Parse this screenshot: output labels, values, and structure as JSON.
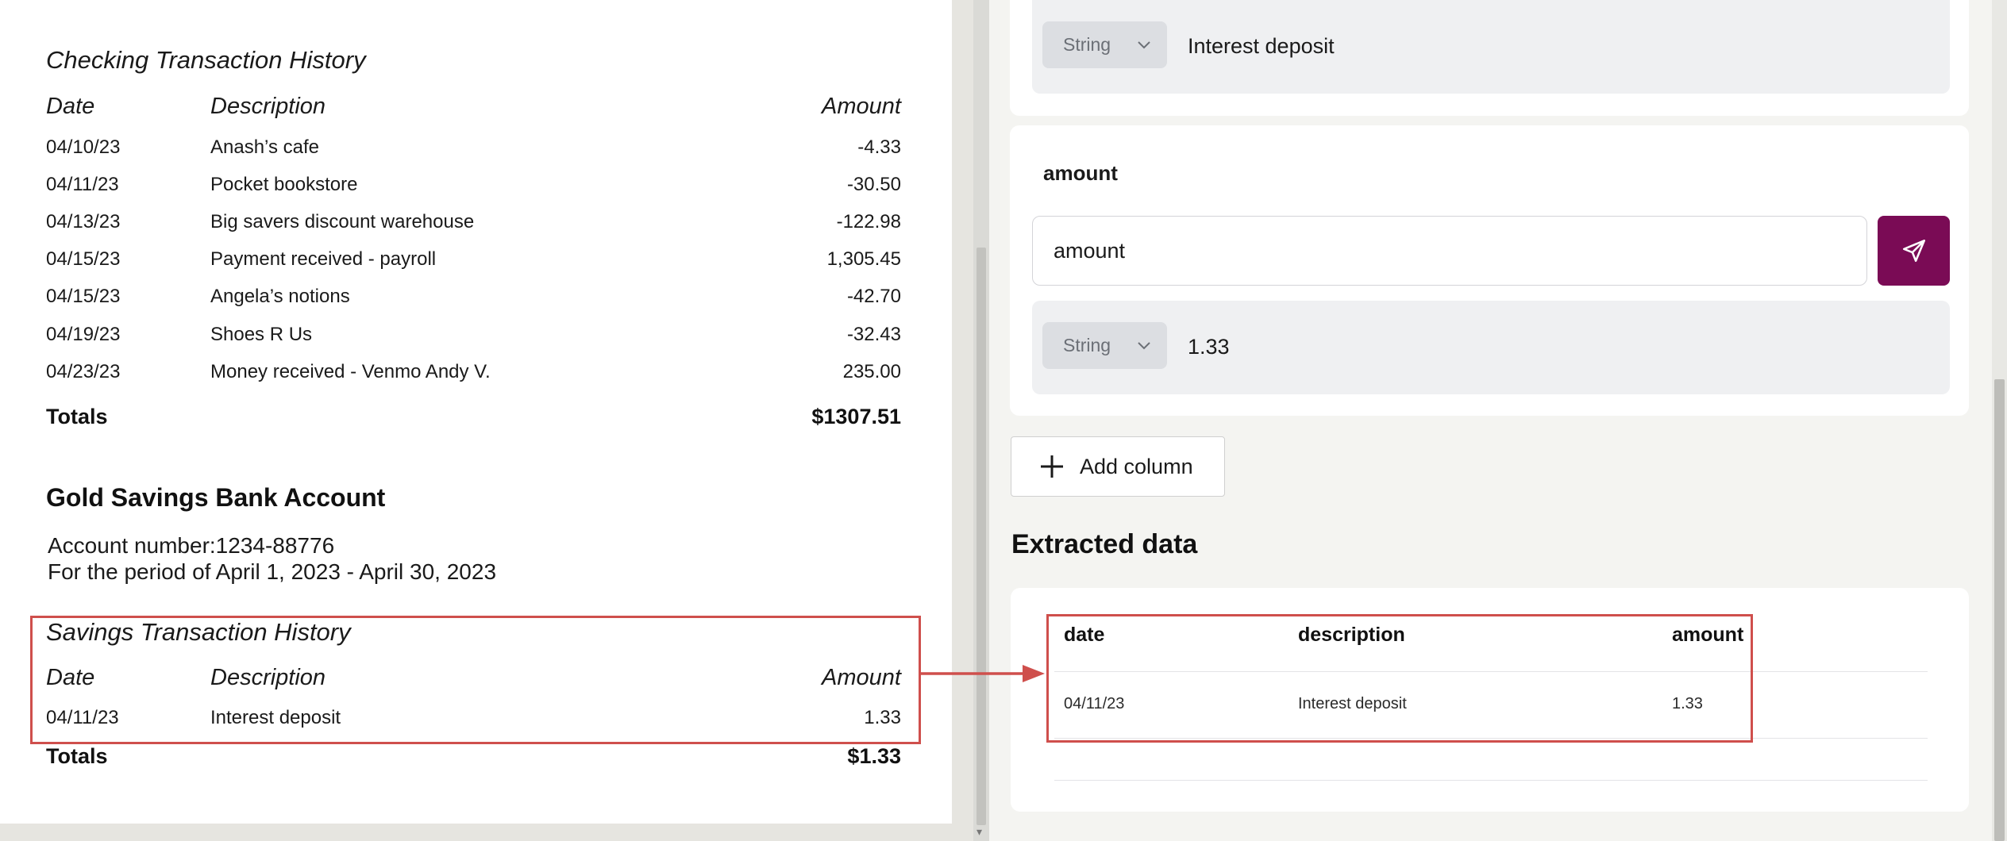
{
  "document": {
    "checking": {
      "title": "Checking Transaction History",
      "headers": {
        "date": "Date",
        "description": "Description",
        "amount": "Amount"
      },
      "rows": [
        {
          "date": "04/10/23",
          "description": "Anash’s cafe",
          "amount": "-4.33"
        },
        {
          "date": "04/11/23",
          "description": "Pocket bookstore",
          "amount": "-30.50"
        },
        {
          "date": "04/13/23",
          "description": "Big savers discount warehouse",
          "amount": "-122.98"
        },
        {
          "date": "04/15/23",
          "description": "Payment received - payroll",
          "amount": "1,305.45"
        },
        {
          "date": "04/15/23",
          "description": "Angela’s notions",
          "amount": "-42.70"
        },
        {
          "date": "04/19/23",
          "description": "Shoes R Us",
          "amount": "-32.43"
        },
        {
          "date": "04/23/23",
          "description": "Money received - Venmo Andy V.",
          "amount": "235.00"
        }
      ],
      "totals_label": "Totals",
      "totals_value": "$1307.51"
    },
    "savings_account": {
      "title": "Gold Savings Bank Account",
      "account_line": "Account number:1234-88776",
      "period_line": "For the period of April 1, 2023 - April 30, 2023"
    },
    "savings": {
      "title": "Savings Transaction History",
      "headers": {
        "date": "Date",
        "description": "Description",
        "amount": "Amount"
      },
      "rows": [
        {
          "date": "04/11/23",
          "description": "Interest deposit",
          "amount": "1.33"
        }
      ],
      "totals_label": "Totals",
      "totals_value": "$1.33"
    }
  },
  "panel": {
    "description_field": {
      "type_label": "String",
      "value": "Interest deposit"
    },
    "amount_field": {
      "label": "amount",
      "input_value": "amount",
      "type_label": "String",
      "value": "1.33"
    },
    "add_column_label": "Add column",
    "extracted": {
      "heading": "Extracted data",
      "columns": [
        "date",
        "description",
        "amount"
      ],
      "rows": [
        [
          "04/11/23",
          "Interest deposit",
          "1.33"
        ]
      ]
    }
  },
  "colors": {
    "accent": "#7a0b55",
    "highlight": "#cf4f4c"
  }
}
